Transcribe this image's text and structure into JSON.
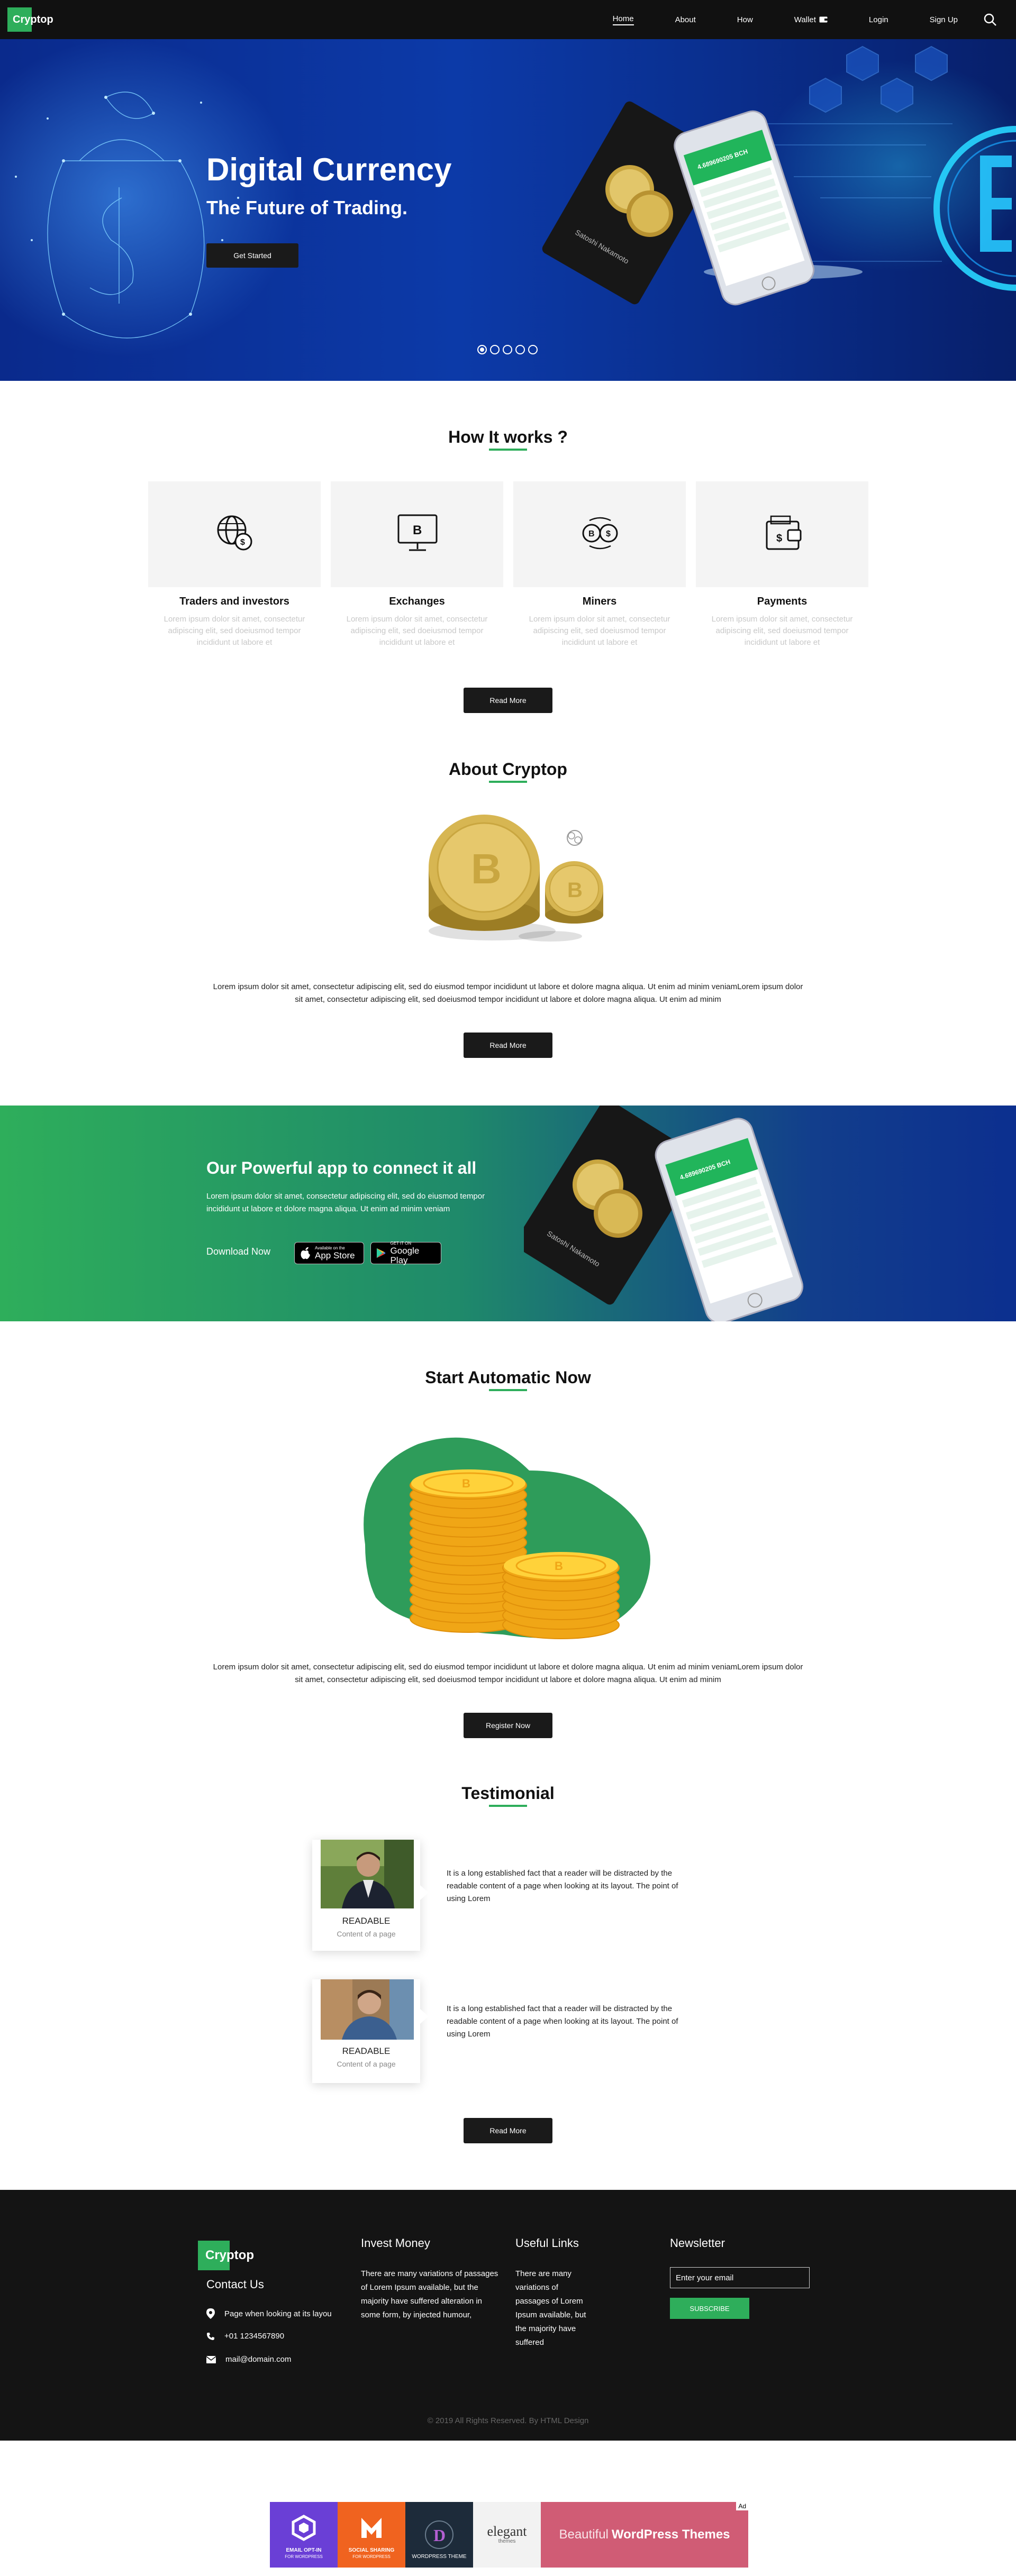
{
  "colors": {
    "accent": "#2eae5b",
    "nav_bg": "#111111",
    "hero_blue": "#0c3aa8",
    "footer_bg": "#141414"
  },
  "nav": {
    "logo": "Cryptop",
    "links": [
      "Home",
      "About",
      "How",
      "Wallet",
      "Login",
      "Sign Up"
    ],
    "active": "Home"
  },
  "hero": {
    "title": "Digital Currency",
    "subtitle": "The Future of Trading.",
    "button": "Get Started",
    "slide_count": 5,
    "active_slide": 1,
    "phone_header": "4.689690205 BCH"
  },
  "how": {
    "title": "How It works ?",
    "cards": [
      {
        "title": "Traders and investors",
        "text": "Lorem ipsum dolor sit amet, consectetur adipiscing elit, sed doeiusmod tempor incididunt ut labore et",
        "icon": "globe-dollar-icon"
      },
      {
        "title": "Exchanges",
        "text": "Lorem ipsum dolor sit amet, consectetur adipiscing elit, sed doeiusmod tempor incididunt ut labore et",
        "icon": "monitor-bitcoin-icon"
      },
      {
        "title": "Miners",
        "text": "Lorem ipsum dolor sit amet, consectetur adipiscing elit, sed doeiusmod tempor incididunt ut labore et",
        "icon": "exchange-coins-icon"
      },
      {
        "title": "Payments",
        "text": "Lorem ipsum dolor sit amet, consectetur adipiscing elit, sed doeiusmod tempor incididunt ut labore et",
        "icon": "wallet-dollar-icon"
      }
    ],
    "button": "Read More"
  },
  "about": {
    "title": "About Cryptop",
    "text": "Lorem ipsum dolor sit amet, consectetur adipiscing elit, sed do eiusmod tempor incididunt ut labore et dolore magna aliqua. Ut enim ad minim veniamLorem ipsum dolor sit amet, consectetur adipiscing elit, sed doeiusmod tempor incididunt ut labore et dolore magna aliqua. Ut enim ad minim",
    "button": "Read More"
  },
  "app": {
    "title": "Our Powerful app to connect it all",
    "text": "Lorem ipsum dolor sit amet, consectetur adipiscing elit, sed do eiusmod tempor incididunt ut labore et dolore magna aliqua. Ut enim ad minim veniam",
    "download_label": "Download Now",
    "appstore_small": "Available on the",
    "appstore_big": "App Store",
    "googleplay_small": "GET IT ON",
    "googleplay_big": "Google Play",
    "card_text": "Satoshi Nakamoto"
  },
  "start": {
    "title": "Start Automatic Now",
    "text": "Lorem ipsum dolor sit amet, consectetur adipiscing elit, sed do eiusmod tempor incididunt ut labore et dolore magna aliqua. Ut enim ad minim veniamLorem ipsum dolor sit amet, consectetur adipiscing elit, sed doeiusmod tempor incididunt ut labore et dolore magna aliqua. Ut enim ad minim",
    "button": "Register Now"
  },
  "testimonial": {
    "title": "Testimonial",
    "items": [
      {
        "name": "READABLE",
        "role": "Content of a page",
        "quote": "It is a long established fact that a reader will be distracted by the readable content of a page when looking at its layout. The point of using Lorem"
      },
      {
        "name": "READABLE",
        "role": "Content of a page",
        "quote": "It is a long established fact that a reader will be distracted by the readable content of a page when looking at its layout. The point of using Lorem"
      }
    ],
    "button": "Read More"
  },
  "footer": {
    "logo": "Cryptop",
    "contact_title": "Contact Us",
    "address": "Page when looking at its layou",
    "phone": "+01 1234567890",
    "email": "mail@domain.com",
    "invest_title": "Invest Money",
    "invest_text": "There are many variations of passages of Lorem Ipsum available, but the majority have suffered alteration in some form, by injected humour,",
    "links_title": "Useful Links",
    "links_text": "There are many variations of passages of Lorem Ipsum available, but the majority have suffered",
    "newsletter_title": "Newsletter",
    "newsletter_placeholder": "Enter your email",
    "subscribe": "SUBSCRIBE",
    "copyright": "© 2019 All Rights Reserved. By HTML Design"
  },
  "ad": {
    "tag": "Ad",
    "tiles": [
      {
        "label1": "EMAIL OPT-IN",
        "label2": "FOR WORDPRESS",
        "color": "#6a3fd6"
      },
      {
        "label1": "SOCIAL SHARING",
        "label2": "FOR WORDPRESS",
        "color": "#f0631f"
      },
      {
        "label1": "WORDPRESS THEME",
        "label2": "",
        "color": "#1d2b3a"
      },
      {
        "label1": "elegant",
        "label2": "themes",
        "color": "#f2f2f2"
      }
    ],
    "headline_light": "Beautiful",
    "headline_bold": "WordPress Themes",
    "headline_bg": "#d05c75"
  }
}
